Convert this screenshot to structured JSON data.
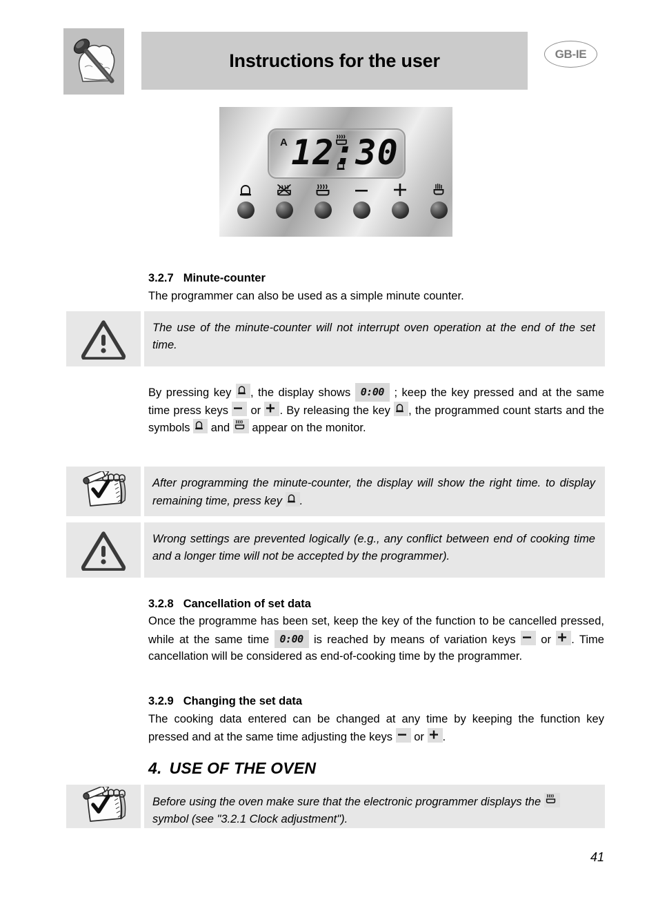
{
  "header": {
    "title": "Instructions for the user",
    "language_badge": "GB-IE",
    "icon": "chef-hat-spoon-icon"
  },
  "programmer_panel": {
    "lcd": {
      "auto_indicator": "A",
      "time": "12:30",
      "symbols_shown": [
        "oven-heat-icon",
        "bell-icon"
      ]
    },
    "buttons": [
      {
        "name": "minute-counter-button",
        "icon": "bell-icon"
      },
      {
        "name": "cooking-time-end-button",
        "icon": "crossed-pot-icon"
      },
      {
        "name": "cooking-time-button",
        "icon": "heated-pot-icon"
      },
      {
        "name": "decrease-button",
        "icon": "minus-icon"
      },
      {
        "name": "increase-button",
        "icon": "plus-icon"
      },
      {
        "name": "manual-mode-button",
        "icon": "hand-icon"
      }
    ]
  },
  "sections": {
    "s327": {
      "number": "3.2.7",
      "title": "Minute-counter",
      "body": "The programmer can also be used as a simple minute counter."
    },
    "s328": {
      "number": "3.2.8",
      "title": "Cancellation of set data",
      "body_part1": "Once the programme has been set, keep the key of the function to be cancelled pressed, while at the same time",
      "body_part2": "is reached by means of variation keys",
      "body_part3": "or",
      "body_part4": ". Time cancellation will be considered as end-of-cooking time by the programmer."
    },
    "s329": {
      "number": "3.2.9",
      "title": "Changing the set data",
      "body_part1": "The cooking data entered can be changed at any time by keeping the function key pressed and at the same time adjusting the keys",
      "body_part2": "or",
      "body_part3": "."
    },
    "s4": {
      "number": "4.",
      "title": "USE OF THE OVEN"
    }
  },
  "main_paragraph": {
    "part1": "By pressing key",
    "part2": ", the display shows",
    "part3": "; keep the key pressed and at the same time press keys",
    "part4": "or",
    "part5": ". By releasing the key",
    "part6": ", the programmed count starts and the symbols",
    "part7": "and",
    "part8": "appear on the monitor."
  },
  "callouts": {
    "warning_1": {
      "icon": "warning-triangle-icon",
      "text": "The use of the minute-counter will not interrupt oven operation at the end of the set time."
    },
    "note_1": {
      "icon": "notepad-check-icon",
      "text_part1": "After programming the minute-counter, the display will show the right time. to display remaining time, press key",
      "text_part2": "."
    },
    "warning_2": {
      "icon": "warning-triangle-icon",
      "text": "Wrong settings are prevented logically (e.g., any conflict between end of cooking time and a longer time will not be accepted by the programmer)."
    },
    "note_2": {
      "icon": "notepad-check-icon",
      "text_part1": "Before using the oven make sure that the electronic programmer displays the",
      "text_part2": "symbol (see \"3.2.1 Clock adjustment\")."
    }
  },
  "lcd_zero": "0:00",
  "footer": {
    "page_number": "41"
  },
  "colors": {
    "header_bar": "#cbcbcb",
    "icon_box": "#c0c0c0",
    "callout_bg": "#e7e7e7",
    "badge_text": "#7d7d7d",
    "inline_symbol_bg": "#dedede"
  }
}
